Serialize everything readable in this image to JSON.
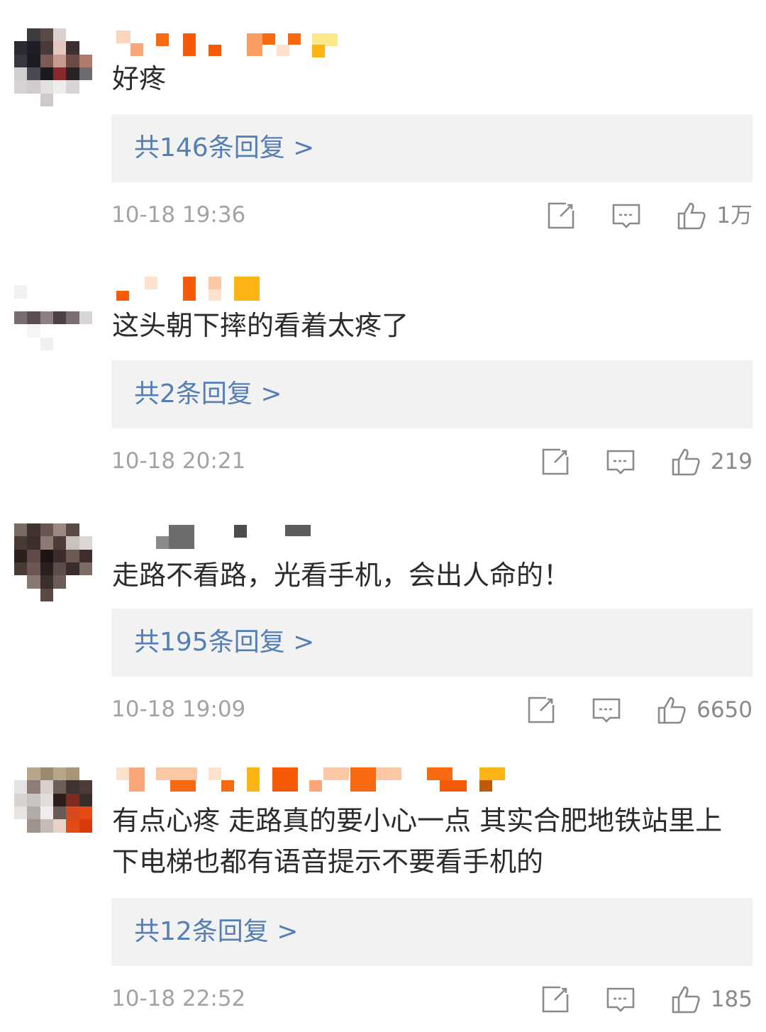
{
  "comments": [
    {
      "text": "好疼",
      "replies": "共146条回复 >",
      "time": "10-18 19:36",
      "likes": "1万"
    },
    {
      "text": "这头朝下摔的看着太疼了",
      "replies": "共2条回复 >",
      "time": "10-18 20:21",
      "likes": "219"
    },
    {
      "text": "走路不看路，光看手机，会出人命的！",
      "replies": "共195条回复 >",
      "time": "10-18 19:09",
      "likes": "6650"
    },
    {
      "text": "有点心疼  走路真的要小心一点  其实合肥地铁站里上下电梯也都有语音提示不要看手机的",
      "replies": "共12条回复 >",
      "time": "10-18 22:52",
      "likes": "185"
    }
  ],
  "colors": {
    "reply_link": "#557fb4",
    "reply_bg": "#f2f2f2",
    "meta_text": "#a3a3a3",
    "body_text": "#2b2b2b",
    "icon": "#8a8a8a"
  },
  "icons": [
    "share-icon",
    "comment-icon",
    "like-icon"
  ]
}
